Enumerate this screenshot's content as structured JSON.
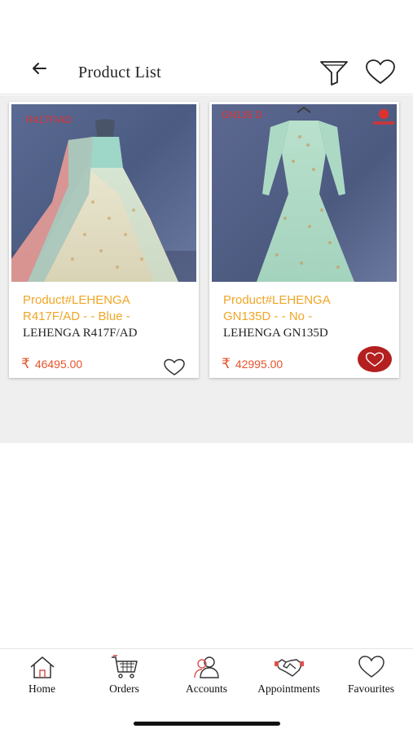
{
  "header": {
    "title": "Product List",
    "back_icon": "back-arrow-icon",
    "filter_icon": "filter-icon",
    "favourite_icon": "heart-outline-icon"
  },
  "products": [
    {
      "sku_tag": "R417F/AD",
      "name_line1": "Product#LEHENGA",
      "name_line2": "R417F/AD - - Blue -",
      "subtitle": "LEHENGA R417F/AD",
      "currency": "₹",
      "price": "46495.00",
      "favourited": false
    },
    {
      "sku_tag": "GN135 D",
      "name_line1": "Product#LEHENGA",
      "name_line2": "GN135D - - No -",
      "subtitle": "LEHENGA GN135D",
      "currency": "₹",
      "price": "42995.00",
      "favourited": true
    }
  ],
  "tabs": [
    {
      "label": "Home",
      "icon": "home-icon"
    },
    {
      "label": "Orders",
      "icon": "cart-icon"
    },
    {
      "label": "Accounts",
      "icon": "users-icon"
    },
    {
      "label": "Appointments",
      "icon": "handshake-icon"
    },
    {
      "label": "Favourites",
      "icon": "heart-icon"
    }
  ],
  "colors": {
    "product_name": "#f0a626",
    "price": "#e8532b",
    "favourite_active": "#b41f1f",
    "background_gray": "#efefef"
  }
}
